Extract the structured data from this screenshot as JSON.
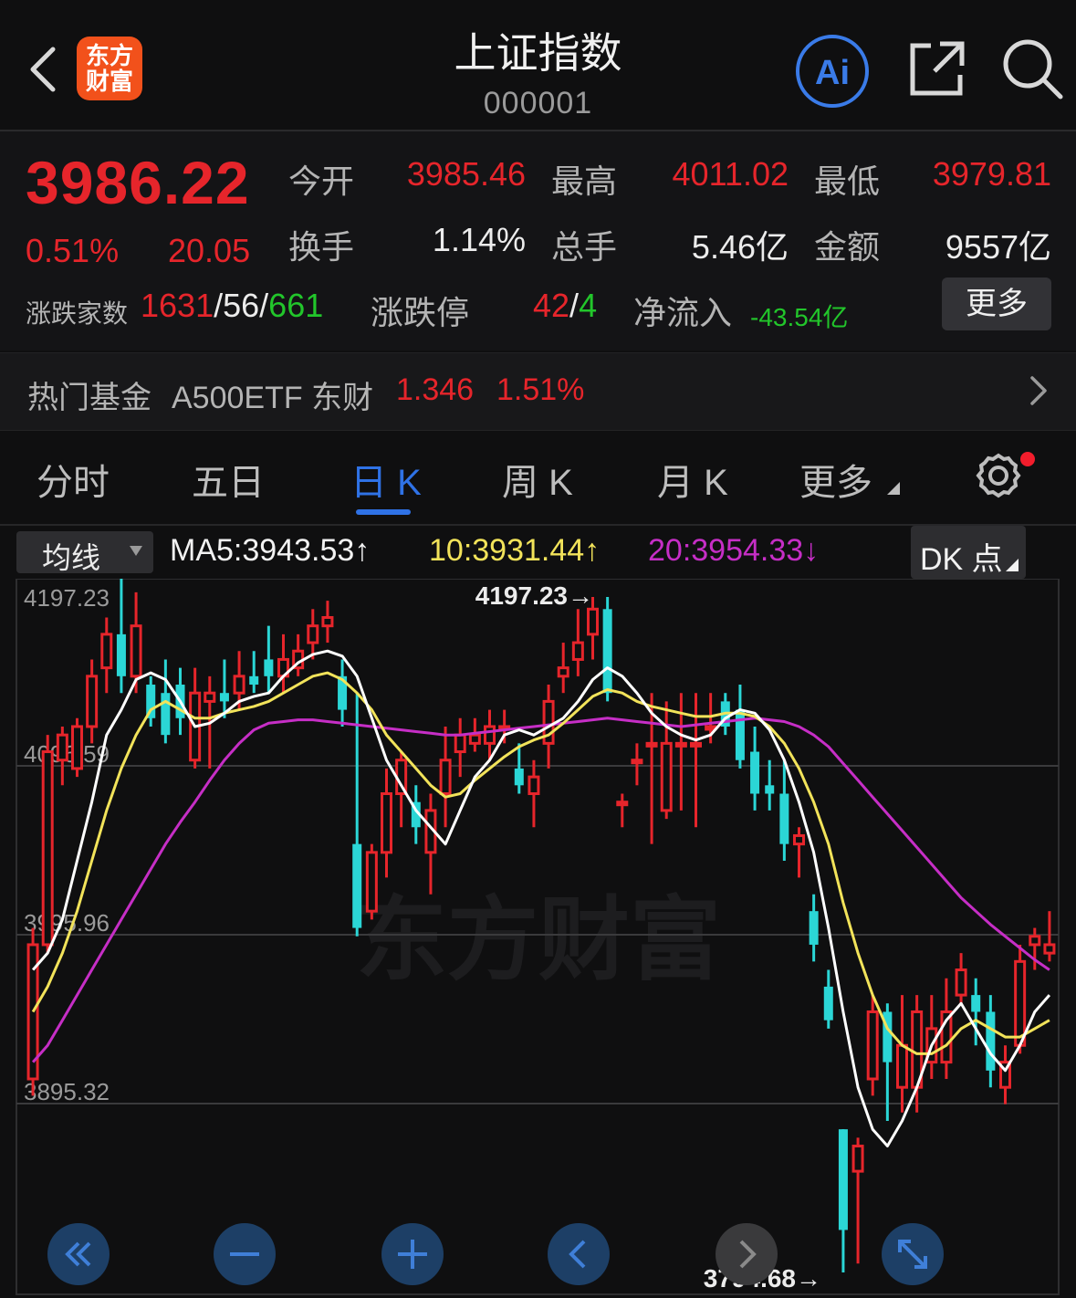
{
  "header": {
    "title": "上证指数",
    "code": "000001",
    "logo_line1": "东方",
    "logo_line2": "财富",
    "ai_label": "Ai"
  },
  "quote": {
    "price": "3986.22",
    "change_pct": "0.51%",
    "change": "20.05",
    "open_label": "今开",
    "open": "3985.46",
    "high_label": "最高",
    "high": "4011.02",
    "low_label": "最低",
    "low": "3979.81",
    "turnover_label": "换手",
    "turnover": "1.14%",
    "volume_label": "总手",
    "volume": "5.46亿",
    "amount_label": "金额",
    "amount": "9557亿",
    "breadth_label": "涨跌家数",
    "up": "1631",
    "flat": "56",
    "down": "661",
    "limit_label": "涨跌停",
    "limit_up": "42",
    "limit_down": "4",
    "netflow_label": "净流入",
    "netflow": "-43.54亿",
    "more_label": "更多"
  },
  "fund": {
    "label": "热门基金",
    "name": "A500ETF 东财",
    "price": "1.346",
    "pct": "1.51%"
  },
  "tabs": [
    "分时",
    "五日",
    "日 K",
    "周 K",
    "月 K",
    "更多"
  ],
  "active_tab": 2,
  "ma_bar": {
    "select": "均线",
    "ma5": "MA5:3943.53↑",
    "ma10": "10:3931.44↑",
    "ma20": "20:3954.33↓",
    "dk": "DK 点"
  },
  "colors": {
    "up": "#e6252b",
    "down": "#2bd6d6",
    "ma5": "#ffffff",
    "ma10": "#f2e35a",
    "ma20": "#c62ec6",
    "accent": "#2f72e6"
  },
  "chart_data": {
    "type": "candlestick",
    "y_ticks": [
      "4197.23",
      "4096.59",
      "3995.96",
      "3895.32"
    ],
    "ylim": [
      3794.68,
      4197.23
    ],
    "high_label": "4197.23→",
    "low_label": "3794.68→",
    "watermark": "东方财富",
    "candles": [
      [
        3910,
        3990,
        3900,
        4000
      ],
      [
        3990,
        4105,
        3985,
        4115
      ],
      [
        4100,
        4115,
        4085,
        4120
      ],
      [
        4095,
        4120,
        4090,
        4125
      ],
      [
        4120,
        4150,
        4110,
        4160
      ],
      [
        4155,
        4175,
        4140,
        4185
      ],
      [
        4175,
        4150,
        4140,
        4210
      ],
      [
        4150,
        4180,
        4140,
        4200
      ],
      [
        4145,
        4125,
        4120,
        4150
      ],
      [
        4140,
        4115,
        4110,
        4160
      ],
      [
        4145,
        4125,
        4115,
        4155
      ],
      [
        4100,
        4140,
        4095,
        4155
      ],
      [
        4135,
        4140,
        4095,
        4150
      ],
      [
        4140,
        4135,
        4125,
        4160
      ],
      [
        4140,
        4150,
        4130,
        4165
      ],
      [
        4150,
        4145,
        4140,
        4165
      ],
      [
        4160,
        4150,
        4140,
        4180
      ],
      [
        4150,
        4160,
        4140,
        4175
      ],
      [
        4155,
        4165,
        4150,
        4175
      ],
      [
        4170,
        4180,
        4160,
        4190
      ],
      [
        4180,
        4185,
        4170,
        4195
      ],
      [
        4150,
        4130,
        4120,
        4160
      ],
      [
        4050,
        4000,
        3995,
        4140
      ],
      [
        4010,
        4045,
        4005,
        4050
      ],
      [
        4045,
        4080,
        4030,
        4095
      ],
      [
        4080,
        4100,
        4060,
        4105
      ],
      [
        4075,
        4060,
        4050,
        4085
      ],
      [
        4045,
        4070,
        4020,
        4080
      ],
      [
        4080,
        4100,
        4060,
        4120
      ],
      [
        4105,
        4115,
        4090,
        4125
      ],
      [
        4110,
        4115,
        4105,
        4125
      ],
      [
        4110,
        4120,
        4100,
        4130
      ],
      [
        4120,
        4120,
        4110,
        4130
      ],
      [
        4095,
        4085,
        4080,
        4110
      ],
      [
        4080,
        4090,
        4060,
        4100
      ],
      [
        4110,
        4135,
        4095,
        4145
      ],
      [
        4150,
        4155,
        4140,
        4170
      ],
      [
        4160,
        4170,
        4150,
        4190
      ],
      [
        4175,
        4190,
        4160,
        4197.23
      ],
      [
        4190,
        4140,
        4135,
        4197.23
      ],
      [
        4075,
        4075,
        4060,
        4080
      ],
      [
        4100,
        4100,
        4085,
        4110
      ],
      [
        4110,
        4110,
        4050,
        4140
      ],
      [
        4070,
        4110,
        4065,
        4135
      ],
      [
        4110,
        4110,
        4070,
        4140
      ],
      [
        4110,
        4110,
        4060,
        4140
      ],
      [
        4120,
        4120,
        4110,
        4140
      ],
      [
        4135,
        4120,
        4115,
        4140
      ],
      [
        4130,
        4100,
        4095,
        4145
      ],
      [
        4105,
        4080,
        4070,
        4120
      ],
      [
        4085,
        4080,
        4070,
        4100
      ],
      [
        4080,
        4050,
        4040,
        4100
      ],
      [
        4050,
        4055,
        4030,
        4060
      ],
      [
        4010,
        3990,
        3980,
        4020
      ],
      [
        3965,
        3945,
        3940,
        3975
      ],
      [
        3880,
        3820,
        3794.68,
        3880
      ],
      [
        3855,
        3870,
        3800,
        3875
      ],
      [
        3910,
        3950,
        3900,
        3960
      ],
      [
        3950,
        3920,
        3885,
        3955
      ],
      [
        3905,
        3930,
        3890,
        3960
      ],
      [
        3905,
        3950,
        3890,
        3960
      ],
      [
        3920,
        3940,
        3910,
        3960
      ],
      [
        3920,
        3950,
        3910,
        3970
      ],
      [
        3960,
        3975,
        3955,
        3985
      ],
      [
        3960,
        3950,
        3930,
        3970
      ],
      [
        3950,
        3915,
        3905,
        3960
      ],
      [
        3905,
        3920,
        3895,
        3930
      ],
      [
        3930,
        3980,
        3925,
        3990
      ],
      [
        3990,
        3995,
        3975,
        4000
      ],
      [
        3985,
        3990,
        3980,
        4010
      ]
    ],
    "ma5": [
      3975,
      3985,
      4005,
      4040,
      4075,
      4115,
      4130,
      4148,
      4152,
      4148,
      4135,
      4120,
      4122,
      4128,
      4135,
      4138,
      4140,
      4150,
      4158,
      4163,
      4165,
      4162,
      4150,
      4125,
      4100,
      4085,
      4070,
      4060,
      4050,
      4070,
      4090,
      4100,
      4115,
      4118,
      4115,
      4120,
      4125,
      4135,
      4148,
      4155,
      4150,
      4140,
      4128,
      4120,
      4115,
      4112,
      4115,
      4125,
      4130,
      4128,
      4118,
      4100,
      4075,
      4045,
      4000,
      3950,
      3905,
      3880,
      3870,
      3885,
      3905,
      3930,
      3945,
      3955,
      3940,
      3925,
      3915,
      3930,
      3950,
      3960
    ],
    "ma10": [
      3950,
      3965,
      3985,
      4010,
      4040,
      4070,
      4095,
      4115,
      4130,
      4135,
      4130,
      4125,
      4125,
      4128,
      4130,
      4132,
      4135,
      4140,
      4145,
      4150,
      4152,
      4148,
      4140,
      4130,
      4115,
      4105,
      4095,
      4085,
      4078,
      4080,
      4088,
      4095,
      4102,
      4108,
      4112,
      4115,
      4122,
      4130,
      4138,
      4142,
      4140,
      4135,
      4132,
      4130,
      4128,
      4126,
      4126,
      4128,
      4128,
      4126,
      4120,
      4110,
      4095,
      4075,
      4050,
      4015,
      3985,
      3960,
      3940,
      3930,
      3925,
      3925,
      3930,
      3940,
      3945,
      3940,
      3935,
      3935,
      3940,
      3945
    ],
    "ma20": [
      3920,
      3930,
      3945,
      3960,
      3975,
      3990,
      4005,
      4020,
      4035,
      4050,
      4063,
      4075,
      4088,
      4100,
      4110,
      4118,
      4122,
      4123,
      4124,
      4124,
      4123,
      4122,
      4121,
      4120,
      4119,
      4118,
      4117,
      4116,
      4115,
      4115,
      4116,
      4117,
      4118,
      4119,
      4120,
      4121,
      4122,
      4123,
      4124,
      4125,
      4124,
      4123,
      4122,
      4121,
      4120,
      4121,
      4122,
      4123,
      4124,
      4125,
      4124,
      4123,
      4120,
      4115,
      4108,
      4098,
      4088,
      4078,
      4068,
      4058,
      4048,
      4038,
      4028,
      4018,
      4010,
      4002,
      3995,
      3988,
      3981,
      3975
    ]
  },
  "nav_buttons": [
    "rewind",
    "zoom-out",
    "zoom-in",
    "prev",
    "next",
    "fullscreen"
  ]
}
